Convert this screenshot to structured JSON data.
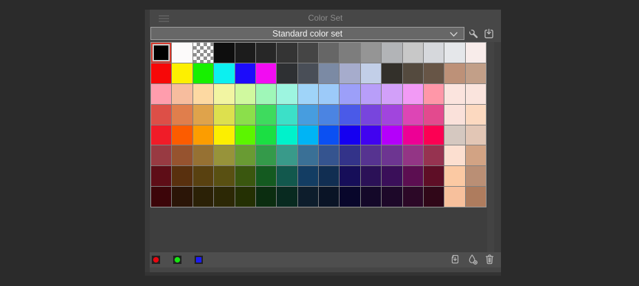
{
  "window": {
    "title": "Color Set"
  },
  "colorset": {
    "selector_value": "Standard color set",
    "selected": {
      "row": 0,
      "col": 0
    },
    "transparent_checker_colors": [
      "#ffffff",
      "#8f8f8f"
    ],
    "rows": [
      [
        "#000000",
        "#fcfafa",
        "transparent",
        "#0e0e0e",
        "#1c1c1c",
        "#272727",
        "#343434",
        "#454545",
        "#666666",
        "#7d7d7d",
        "#959595",
        "#b2b4b7",
        "#c8c8c8",
        "#d6d8dc",
        "#e5e7ea",
        "#f8ecea"
      ],
      [
        "#f70808",
        "#fdf000",
        "#17f000",
        "#0cf0f0",
        "#1c0cfa",
        "#f20cf2",
        "#2e3033",
        "#494e57",
        "#7b8aa4",
        "#a6accc",
        "#c2cfe8",
        "#33302a",
        "#544a3e",
        "#675546",
        "#bd9178",
        "#c29f88"
      ],
      [
        "#ff9dad",
        "#f7bd9e",
        "#fdd9a2",
        "#f2f5a2",
        "#d0f99f",
        "#9ff7b8",
        "#9df5e0",
        "#9fd4f9",
        "#9ccaf9",
        "#9c9ff9",
        "#b89ef9",
        "#d2a0f9",
        "#f29af5",
        "#ff97a8",
        "#fbe4de",
        "#fae4dd"
      ],
      [
        "#dd4f47",
        "#e07e4c",
        "#dfa34b",
        "#dde04e",
        "#8bdf4b",
        "#3edb5e",
        "#3ce0c8",
        "#479ddf",
        "#4b84e2",
        "#4a5ae8",
        "#7845dd",
        "#a145dd",
        "#dd45b5",
        "#e34a8e",
        "#fae1da",
        "#fcd9c0"
      ],
      [
        "#f01c28",
        "#fc5c00",
        "#fc9d00",
        "#fcef00",
        "#5cf500",
        "#1bdf43",
        "#00f2cb",
        "#00b4f5",
        "#0b50f2",
        "#1500f0",
        "#4103f0",
        "#b400fa",
        "#ed0095",
        "#fc0053",
        "#d5c8c0",
        "#e2c6b5"
      ],
      [
        "#983a42",
        "#96532f",
        "#967133",
        "#97933a",
        "#699b33",
        "#349a4a",
        "#399a8a",
        "#3a7096",
        "#35548f",
        "#333389",
        "#563390",
        "#6d3591",
        "#933585",
        "#963350",
        "#fcdfd0",
        "#d2a384"
      ],
      [
        "#5e0d17",
        "#59300e",
        "#594110",
        "#595012",
        "#3a570f",
        "#145a20",
        "#12584d",
        "#133d63",
        "#112e52",
        "#160e59",
        "#2b1157",
        "#3a0f59",
        "#5c0e51",
        "#5e0e26",
        "#fbc9a3",
        "#ba8f75"
      ],
      [
        "#3c0509",
        "#2b1507",
        "#2b2106",
        "#2c2805",
        "#243003",
        "#0b2d10",
        "#082a20",
        "#0d1d2c",
        "#0a1426",
        "#08062b",
        "#140829",
        "#1d0829",
        "#2c0827",
        "#300718",
        "#f7c09c",
        "#ae7c5e"
      ]
    ]
  },
  "icons": {
    "menu": "menu-icon",
    "chevron": "chevron-down-icon",
    "wrench": "wrench-icon",
    "import": "box-down-arrow-icon",
    "replace_color": "page-down-arrow-icon",
    "add_color": "droplet-add-icon",
    "delete_color": "trash-icon"
  },
  "footer": {
    "chips": [
      {
        "name": "red-color",
        "color": "#e8060f",
        "shape": "circle"
      },
      {
        "name": "green-color",
        "color": "#17e312",
        "shape": "circle"
      },
      {
        "name": "blue-color",
        "color": "#1b1bf0",
        "shape": "square"
      }
    ]
  },
  "theme": {
    "outer_bg": "#2b2b2b",
    "panel_bg": "#474747",
    "panel_edge": "#3a3a3a",
    "dropdown_bg": "#676767",
    "grid_line": "#7f7f7f",
    "empty_area": "#3e3e3e",
    "toolbar_bg": "#4e4e4e",
    "icon_stroke": "#bdbdbd",
    "selection_ring": "#d5362a"
  }
}
